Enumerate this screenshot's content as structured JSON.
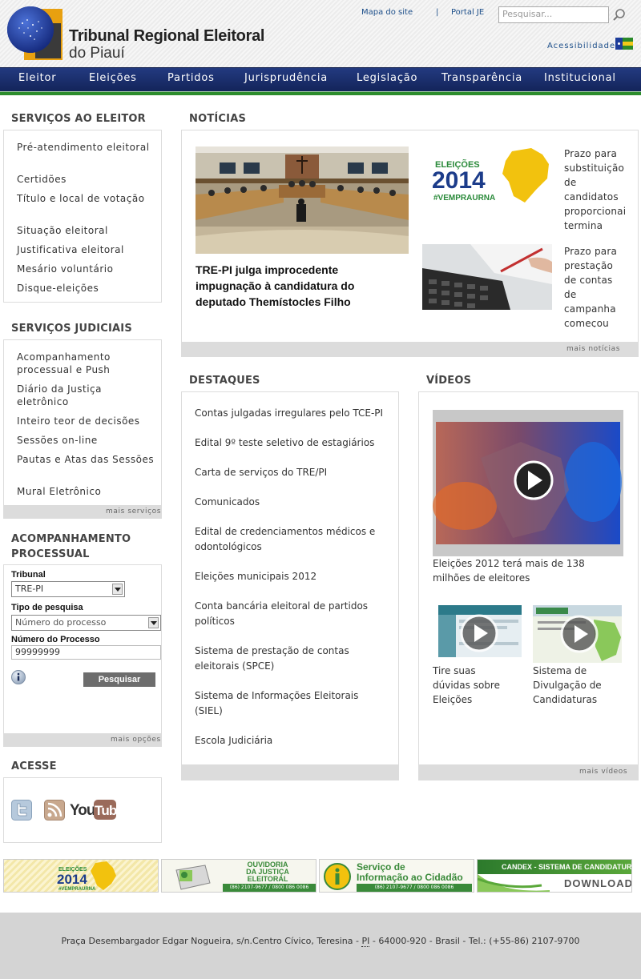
{
  "header": {
    "logo_line1": "Tribunal Regional Eleitoral",
    "logo_line2": "do Piauí",
    "links": [
      "Mapa do site",
      "|",
      "Portal JE"
    ],
    "search_placeholder": "Pesquisar...",
    "accessibility": "Acessibilidade"
  },
  "nav": [
    "Eleitor",
    "Eleições",
    "Partidos",
    "Jurisprudência",
    "Legislação",
    "Transparência",
    "Institucional"
  ],
  "sidebar": {
    "servicos_eleitor": {
      "title": "SERVIÇOS AO ELEITOR",
      "items": [
        "Pré-atendimento eleitoral",
        "Certidões",
        "Título e local de votação",
        "Situação eleitoral",
        "Justificativa eleitoral",
        "Mesário voluntário",
        "Disque-eleições"
      ]
    },
    "servicos_judiciais": {
      "title": "SERVIÇOS JUDICIAIS",
      "items": [
        "Acompanhamento processual e Push",
        "Diário da Justiça eletrônico",
        "Inteiro teor de decisões",
        "Sessões on-line",
        "Pautas e Atas das Sessões",
        "Mural Eletrônico"
      ],
      "more": "mais serviços"
    },
    "acompanhamento": {
      "title": "ACOMPANHAMENTO PROCESSUAL",
      "tribunal_label": "Tribunal",
      "tribunal_value": "TRE-PI",
      "tipo_label": "Tipo de pesquisa",
      "tipo_value": "Número do processo",
      "numero_label": "Número do Processo",
      "numero_value": "99999999",
      "button": "Pesquisar",
      "more": "mais opções"
    },
    "acesse": {
      "title": "ACESSE",
      "youtube_text": "YouTube"
    }
  },
  "noticias": {
    "title": "NOTÍCIAS",
    "main_title": "TRE-PI julga improcedente impugnação à candidatura do deputado Themístocles Filho",
    "item1_text": "Prazo para substituição de candidatos proporcionais termina",
    "item2_text": "Prazo para prestação de contas de campanha começou dia",
    "badge_eleicoes": "ELEIÇÕES",
    "badge_year": "2014",
    "badge_tag": "#VEMPRAURNA",
    "more": "mais notícias"
  },
  "destaques": {
    "title": "DESTAQUES",
    "items": [
      "Contas julgadas irregulares pelo TCE-PI",
      "Edital 9º teste seletivo de estagiários",
      "Carta de serviços do TRE/PI",
      "Comunicados",
      "Edital de credenciamentos médicos e odontológicos",
      "Eleições municipais 2012",
      "Conta bancária eleitoral de partidos políticos",
      "Sistema de prestação de contas eleitorais (SPCE)",
      "Sistema de Informações Eleitorais (SIEL)",
      "Escola Judiciária"
    ]
  },
  "videos": {
    "title": "VÍDEOS",
    "main_caption": "Eleições 2012 terá mais de 138 milhões de eleitores",
    "v1_caption": "Tire suas dúvidas sobre Eleições",
    "v2_caption": "Sistema de Divulgação de Candidaturas",
    "more": "mais vídeos"
  },
  "banners": {
    "b1_line1": "ELEIÇÕES",
    "b1_line2": "2014",
    "b1_line3": "#VEMPRAURNA",
    "b2_line1": "OUVIDORIA",
    "b2_line2": "DA JUSTIÇA",
    "b2_line3": "ELEITORAL",
    "b2_phone": "(86) 2107-9677 / 0800 086 0086",
    "b3_line1": "Serviço de",
    "b3_line2": "Informação ao Cidadão",
    "b3_phone": "(86) 2107-9677 / 0800 086 0086",
    "b4_line1": "CANDEX - SISTEMA DE CANDIDATURA",
    "b4_line2": "DOWNLOAD"
  },
  "footer": {
    "address_pre": "Praça Desembargador Edgar Nogueira, s/n.Centro Cívico, Teresina - ",
    "address_pi": "PI",
    "address_post": "- 64000-920 - Brasil - Tel.: (+55-86) 2107-9700"
  }
}
